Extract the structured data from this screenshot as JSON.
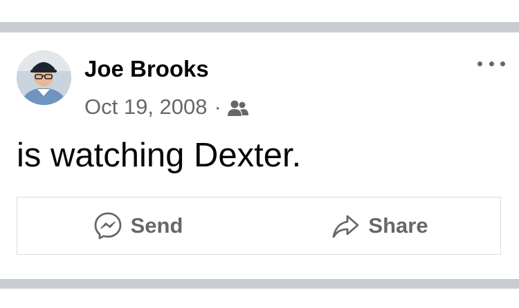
{
  "post": {
    "author": "Joe Brooks",
    "date": "Oct 19, 2008",
    "separator": "·",
    "audience_icon": "friends-icon",
    "text": "is watching Dexter.",
    "more_icon": "more-options-icon"
  },
  "actions": {
    "send_label": "Send",
    "send_icon": "messenger-icon",
    "share_label": "Share",
    "share_icon": "share-arrow-icon"
  },
  "colors": {
    "divider": "#c9ccd1",
    "text_primary": "#050505",
    "text_secondary": "#65676b",
    "border": "#dadde1"
  }
}
